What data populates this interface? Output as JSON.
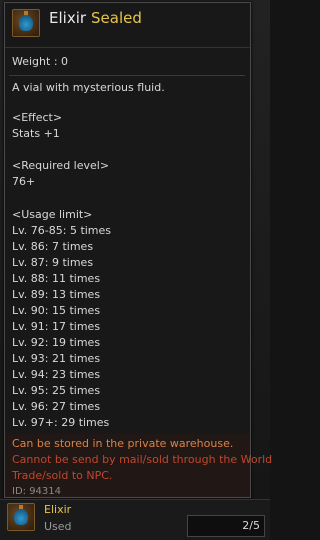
{
  "item": {
    "name": "Elixir",
    "status": "Sealed",
    "weight": "Weight : 0",
    "description": "A vial with mysterious fluid.",
    "effect_header": "<Effect>",
    "effect": "Stats +1",
    "required_level_header": "<Required level>",
    "required_level": "76+",
    "usage_limit_header": "<Usage limit>",
    "usage_limits": [
      "Lv. 76-85: 5 times",
      "Lv. 86: 7 times",
      "Lv. 87: 9 times",
      "Lv. 88: 11 times",
      "Lv. 89: 13 times",
      "Lv. 90: 15 times",
      "Lv. 91: 17 times",
      "Lv. 92: 19 times",
      "Lv. 93: 21 times",
      "Lv. 94: 23 times",
      "Lv. 95: 25 times",
      "Lv. 96: 27 times",
      "Lv. 97+: 29 times"
    ],
    "storage_note": "Can be stored in the private warehouse.",
    "restriction_note_1": "Cannot be send by mail/sold through the World",
    "restriction_note_2": "Trade/sold to NPC.",
    "id_text": "ID: 94314"
  },
  "bottom_slot": {
    "name": "Elixir",
    "state": "Used",
    "count": "2/5"
  },
  "colors": {
    "accent": "#e8c64a",
    "storage": "#d9844a",
    "restriction": "#c0472e"
  },
  "icons": {
    "item": "elixir-vial-icon"
  }
}
